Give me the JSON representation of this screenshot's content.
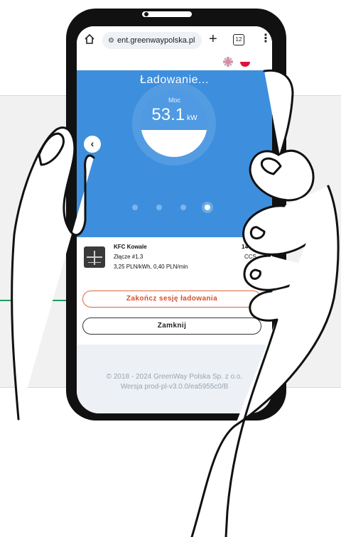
{
  "browser": {
    "url": "ent.greenwaypolska.pl",
    "tab_count": "12",
    "new_tab_label": "+",
    "menu_label": "⋮"
  },
  "charging": {
    "title": "Ładowanie...",
    "gauge": {
      "label": "Moc",
      "value": "53.1",
      "unit": "kW",
      "fill_fraction": 0.4
    },
    "carousel_dots": 4,
    "active_dot": 3
  },
  "station": {
    "name": "KFC Kowale",
    "connector": "Złącze #1.3",
    "price": "3,25 PLN/kWh, 0,40 PLN/min",
    "power": "14",
    "plug_type": "CCS"
  },
  "actions": {
    "end_session": "Zakończ sesję ładowania",
    "close": "Zamknij"
  },
  "footer": {
    "copyright": "© 2018 - 2024 GreenWay Polska Sp. z o.o.",
    "version": "Wersja prod-pl-v3.0.0/ea5955c0/B"
  },
  "colors": {
    "panel_blue": "#3d8fdd",
    "end_session_accent": "#d64f2a",
    "callout_green": "#1f9b67"
  }
}
